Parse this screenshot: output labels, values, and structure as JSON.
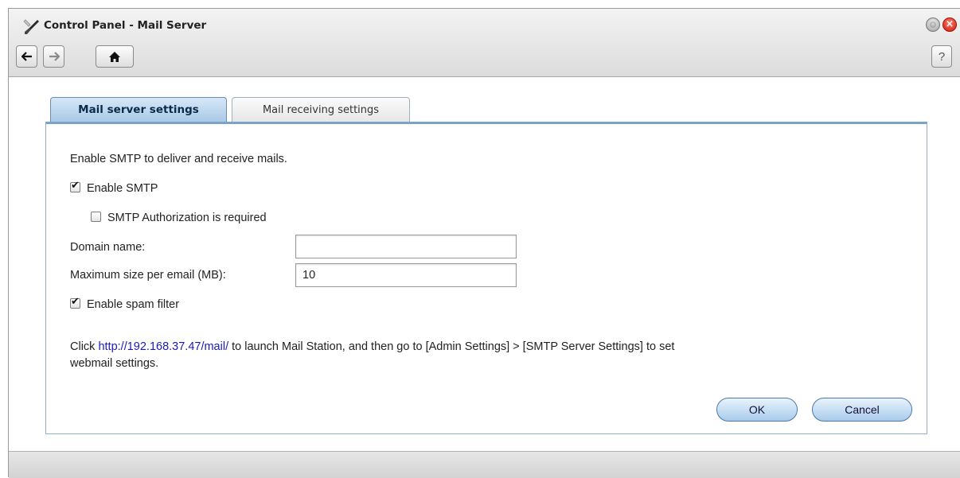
{
  "window": {
    "title": "Control Panel - Mail Server",
    "close_glyph": "×"
  },
  "toolbar": {
    "help_label": "?"
  },
  "tabs": [
    {
      "label": "Mail server settings",
      "active": true
    },
    {
      "label": "Mail receiving settings",
      "active": false
    }
  ],
  "form": {
    "intro": "Enable SMTP to deliver and receive mails.",
    "enable_smtp": {
      "label": "Enable SMTP",
      "checked": true
    },
    "smtp_auth": {
      "label": "SMTP Authorization is required",
      "checked": false
    },
    "domain_name": {
      "label": "Domain name:",
      "value": ""
    },
    "max_size": {
      "label": "Maximum size per email (MB):",
      "value": "10"
    },
    "spam_filter": {
      "label": "Enable spam filter",
      "checked": true
    }
  },
  "info": {
    "prefix": "Click ",
    "link": "http://192.168.37.47/mail/",
    "suffix_line1": " to launch Mail Station, and then go to [Admin Settings] > [SMTP Server Settings] to set",
    "line2": "webmail settings."
  },
  "buttons": {
    "ok": "OK",
    "cancel": "Cancel"
  },
  "colors": {
    "active_tab": "#a9c9e6",
    "link": "#1a1ab8",
    "panel_border": "#7aa3c8",
    "close_button": "#d01b0a"
  },
  "icons": [
    "control-panel-icon",
    "back-arrow-icon",
    "forward-arrow-icon",
    "home-icon",
    "help-icon",
    "minimize-icon",
    "close-icon",
    "checkbox-checked-icon",
    "checkbox-unchecked-icon"
  ]
}
